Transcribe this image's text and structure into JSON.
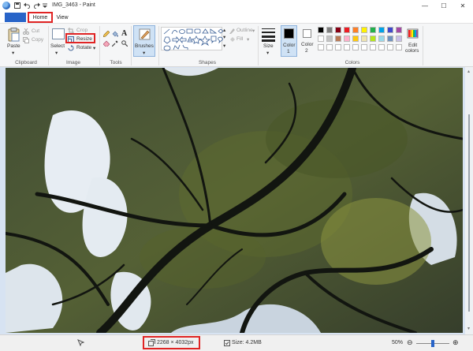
{
  "window": {
    "title": "IMG_3463 - Paint",
    "minimize": "—",
    "maximize": "☐",
    "close": "✕"
  },
  "quick_access": {
    "save_icon": "save-icon",
    "undo_icon": "undo-icon",
    "redo_icon": "redo-icon",
    "customize_icon": "customize-icon"
  },
  "menu": {
    "home": "Home",
    "view": "View"
  },
  "ribbon": {
    "clipboard": {
      "paste": "Paste",
      "cut": "Cut",
      "copy": "Copy",
      "label": "Clipboard"
    },
    "image": {
      "select": "Select",
      "crop": "Crop",
      "resize": "Resize",
      "rotate": "Rotate",
      "label": "Image"
    },
    "tools": {
      "label": "Tools"
    },
    "brushes": {
      "label": "Brushes"
    },
    "shapes": {
      "outline": "Outline",
      "fill": "Fill",
      "label": "Shapes"
    },
    "size": {
      "label": "Size"
    },
    "colors": {
      "color1": "Color",
      "color1_num": "1",
      "color2": "Color",
      "color2_num": "2",
      "edit_colors_1": "Edit",
      "edit_colors_2": "colors",
      "label": "Colors",
      "accent": "#2864c8",
      "color1_value": "#000000",
      "color2_value": "#ffffff",
      "palette_row1": [
        "#000000",
        "#7f7f7f",
        "#880015",
        "#ed1c24",
        "#ff7f27",
        "#fff200",
        "#22b14c",
        "#00a2e8",
        "#3f48cc",
        "#a349a4"
      ],
      "palette_row2": [
        "#ffffff",
        "#c3c3c3",
        "#b97a57",
        "#ffaec9",
        "#ffc90e",
        "#efe4b0",
        "#b5e61d",
        "#99d9ea",
        "#7092be",
        "#c8bfe7"
      ],
      "palette_row3": [
        "#ffffff",
        "#ffffff",
        "#ffffff",
        "#ffffff",
        "#ffffff",
        "#ffffff",
        "#ffffff",
        "#ffffff",
        "#ffffff",
        "#ffffff"
      ]
    }
  },
  "status": {
    "dimensions": "2268 × 4032px",
    "size": "Size: 4.2MB",
    "zoom": "50%",
    "zoom_level": 0.5,
    "highlight": "#e02424"
  }
}
